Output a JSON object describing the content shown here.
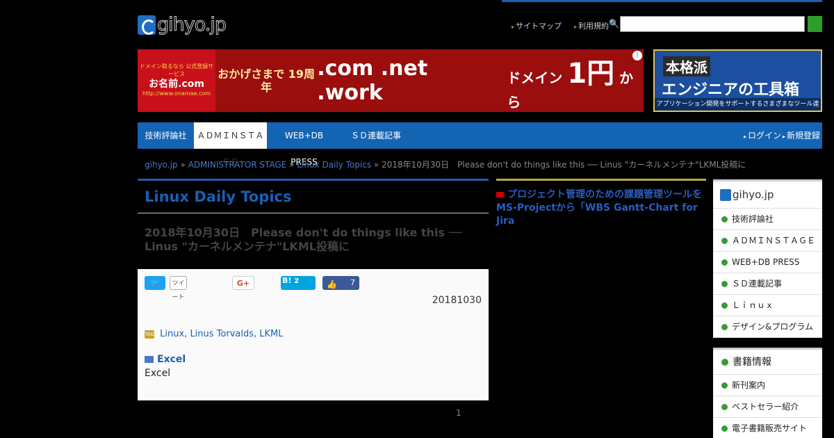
{
  "logo": {
    "text": "gihyo.jp"
  },
  "header": {
    "links": [
      "サイトマップ",
      "利用規約"
    ],
    "search_placeholder": ""
  },
  "banner_main": {
    "left_small": "ドメイン取るなら 公式登録サービス",
    "left_brand": "お名前.com",
    "left_url": "http://www.onamae.com",
    "anniversary": "おかげさまで 19周年",
    "domains": ".com .net .work",
    "price_label": "ドメイン",
    "price_value": "1円",
    "price_suffix": "から",
    "info": "i"
  },
  "banner_side": {
    "line1": "本格派",
    "line2": "エンジニアの工具箱",
    "line3": "アプリケーション開発をサポートするさまざまなツール達"
  },
  "nav": {
    "items": [
      "技術評論社",
      "ＡＤＭＩＮＳＴＡＧＥ",
      "WEB+DB PRESS",
      "ＳＤ連載記事"
    ],
    "right": [
      "ログイン",
      "新規登録"
    ]
  },
  "breadcrumb": {
    "home": "gihyo.jp",
    "sep1": "»",
    "section": "ADMINISTRATOR STAGE",
    "sep2": "»",
    "category": "Linux Daily Topics",
    "sep3": "»",
    "current": "2018年10月30日　Please don't do things like this ── Linus \"カーネルメンテナ\"LKML投稿に"
  },
  "article": {
    "category_title": "Linux Daily Topics",
    "title": "2018年10月30日　Please don't do things like this ── Linus \"カーネルメンテナ\"LKML投稿に",
    "share": {
      "twitter": "🐦",
      "twitter_count": "ツイート",
      "gplus": "G+",
      "hatena": "B!",
      "hatena_count": "2",
      "fb_count": "7"
    },
    "date": "20181030",
    "tags": [
      "Linux",
      "Linus Torvalds",
      "LKML"
    ],
    "tag_sep": ", ",
    "tag_icon_text": "TAG",
    "excel_heading": "Excel",
    "excel_text": "Excel",
    "pager": "1"
  },
  "mid": {
    "link_line1": "プロジェクト管理のための課題管理ツールを",
    "link_line2": "MS-Projectから「WBS Gantt-Chart for Jira"
  },
  "side_nav": {
    "logo_text": "gihyo.jp",
    "items": [
      "技術評論社",
      "ＡＤＭＩＮＳＴＡＧＥ",
      "WEB+DB PRESS",
      "ＳＤ連載記事",
      "Ｌｉｎｕｘ",
      "デザイン&プログラム"
    ]
  },
  "side_box2": {
    "heading": "書籍情報",
    "items": [
      "新刊案内",
      "ベストセラー紹介",
      "電子書籍販売サイト"
    ]
  }
}
